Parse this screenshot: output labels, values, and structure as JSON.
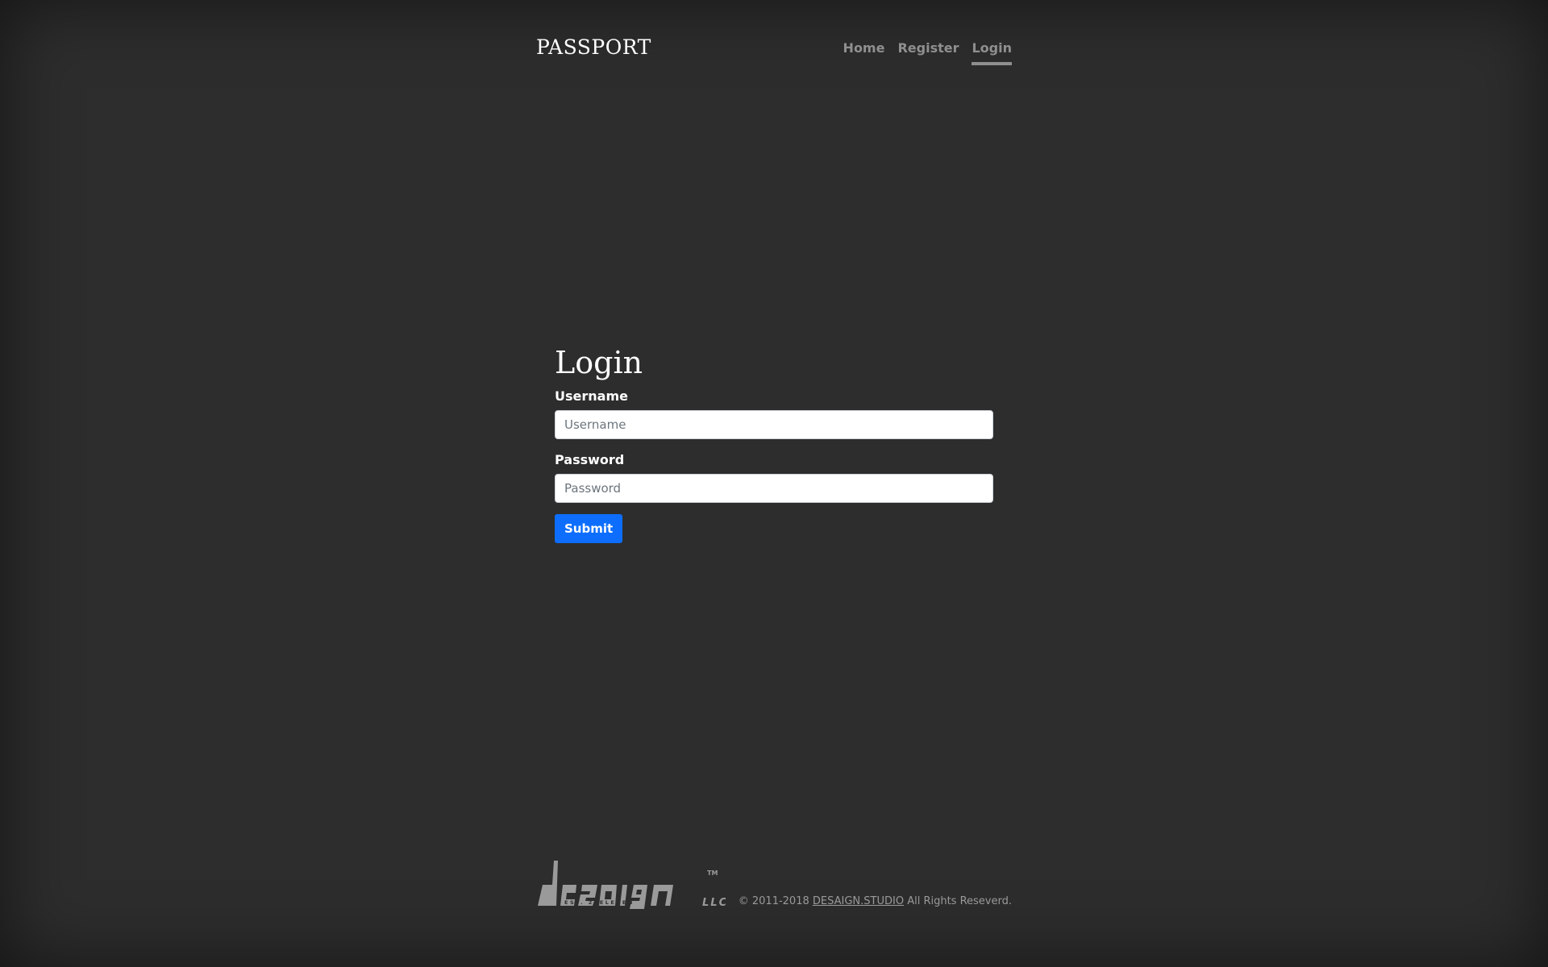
{
  "header": {
    "brand": "PASSPORT",
    "nav": [
      {
        "label": "Home",
        "active": false
      },
      {
        "label": "Register",
        "active": false
      },
      {
        "label": "Login",
        "active": true
      }
    ]
  },
  "login": {
    "title": "Login",
    "username": {
      "label": "Username",
      "placeholder": "Username",
      "value": ""
    },
    "password": {
      "label": "Password",
      "placeholder": "Password",
      "value": ""
    },
    "submit_label": "Submit"
  },
  "footer": {
    "logo": {
      "wordmark": "desaign",
      "tagline": "EST. 20ELEVEN",
      "suffix": "LLC",
      "trademark": "TM"
    },
    "copyright_prefix": "© 2011-2018",
    "link_label": "DESAIGN.STUDIO",
    "copyright_suffix": "All Rights Reseverd."
  },
  "colors": {
    "background": "#2d2d2d",
    "primary_button": "#0d6efd",
    "nav_link": "#8f8f8f",
    "footer_text": "#9a9a9a"
  }
}
